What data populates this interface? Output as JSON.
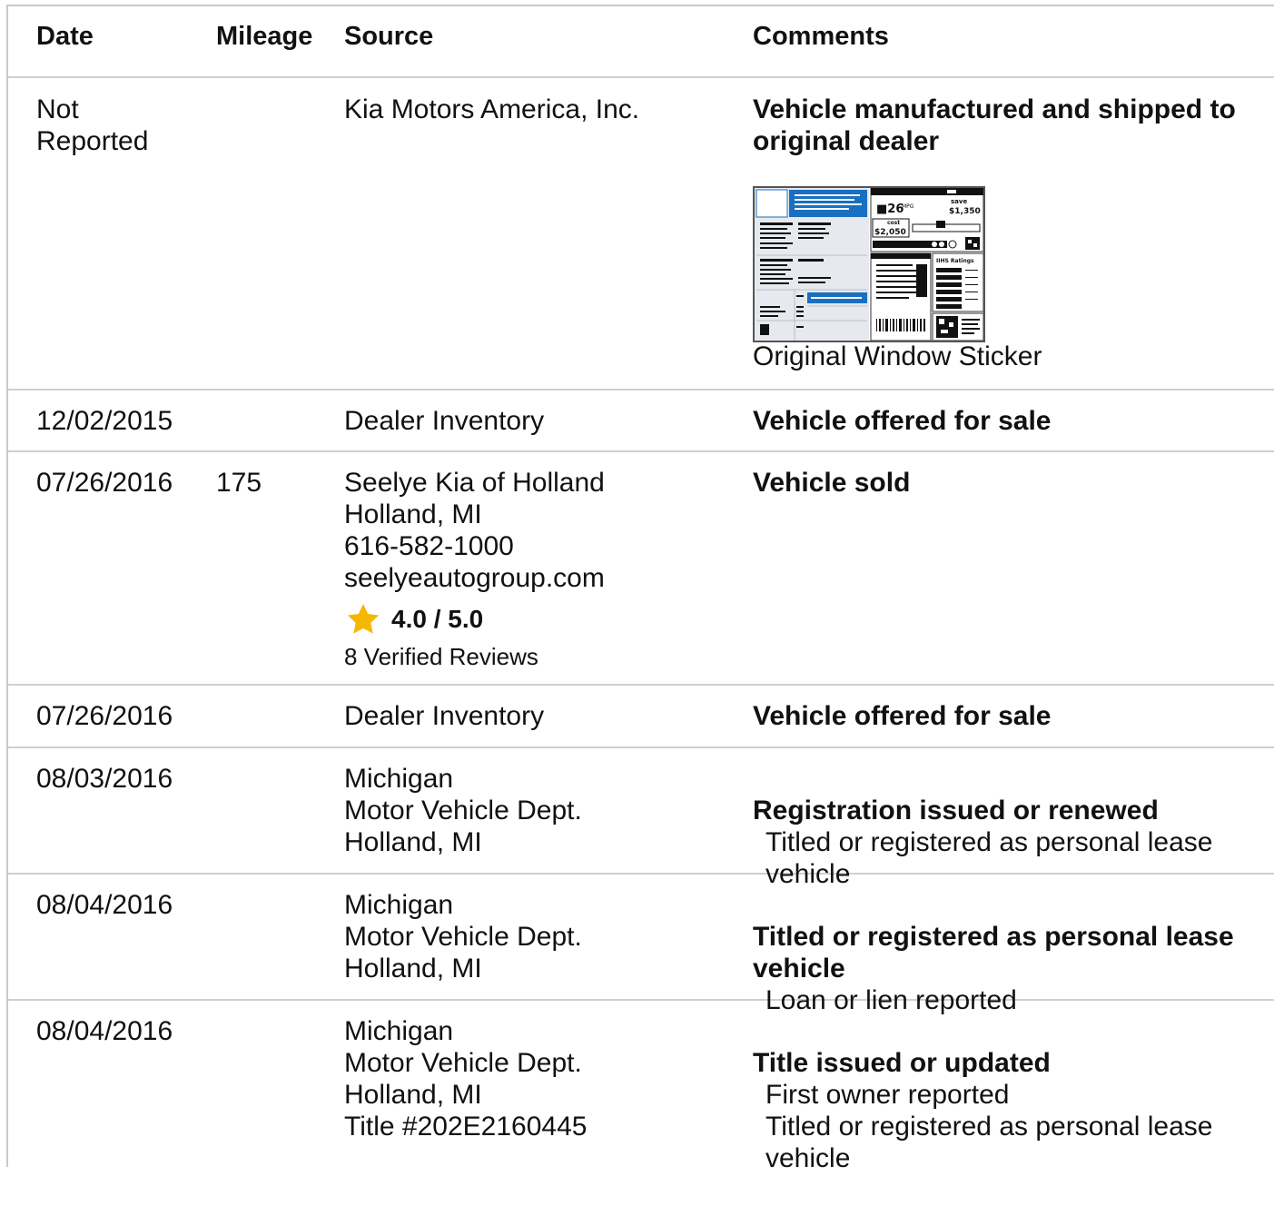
{
  "headers": {
    "date": "Date",
    "mileage": "Mileage",
    "source": "Source",
    "comments": "Comments"
  },
  "rows": [
    {
      "date": "Not\nReported",
      "mileage": "",
      "source": "Kia Motors America, Inc.",
      "comment_title": "Vehicle manufactured and shipped to original dealer",
      "comment_details": "",
      "sticker_caption": "Original Window Sticker",
      "sticker": {
        "mpg": "26",
        "mpg_unit": "MPG",
        "save_label": "save",
        "save_amount": "$1,350",
        "cost_label": "cost",
        "cost_amount": "$2,050",
        "ratings_label": "IIHS Ratings"
      }
    },
    {
      "date": "12/02/2015",
      "mileage": "",
      "source": "Dealer Inventory",
      "comment_title": "Vehicle offered for sale",
      "comment_details": ""
    },
    {
      "date": "07/26/2016",
      "mileage": "175",
      "source": "Seelye Kia of Holland\nHolland, MI\n616-582-1000\nseelyeautogroup.com",
      "comment_title": "Vehicle sold",
      "comment_details": "",
      "rating": "4.0 / 5.0",
      "rating_value": 4.0,
      "rating_max": 5.0,
      "reviews": "8 Verified Reviews"
    },
    {
      "date": "07/26/2016",
      "mileage": "",
      "source": "Dealer Inventory",
      "comment_title": "Vehicle offered for sale",
      "comment_details": ""
    },
    {
      "date": "08/03/2016",
      "mileage": "",
      "source": "Michigan\nMotor Vehicle Dept.\nHolland, MI",
      "comment_title": "Registration issued or renewed",
      "comment_details": "Titled or registered as personal lease\nvehicle"
    },
    {
      "date": "08/04/2016",
      "mileage": "",
      "source": "Michigan\nMotor Vehicle Dept.\nHolland, MI",
      "comment_title": "Titled or registered as personal lease vehicle",
      "comment_details": "Loan or lien reported"
    },
    {
      "date": "08/04/2016",
      "mileage": "",
      "source": "Michigan\nMotor Vehicle Dept.\nHolland, MI\nTitle #202E2160445",
      "comment_title": "Title issued or updated",
      "comment_details": "First owner reported\nTitled or registered as personal lease\nvehicle"
    }
  ],
  "colors": {
    "divider": "#cfcfcf",
    "star": "#f5b800",
    "sticker_blue": "#1a6fc0"
  }
}
